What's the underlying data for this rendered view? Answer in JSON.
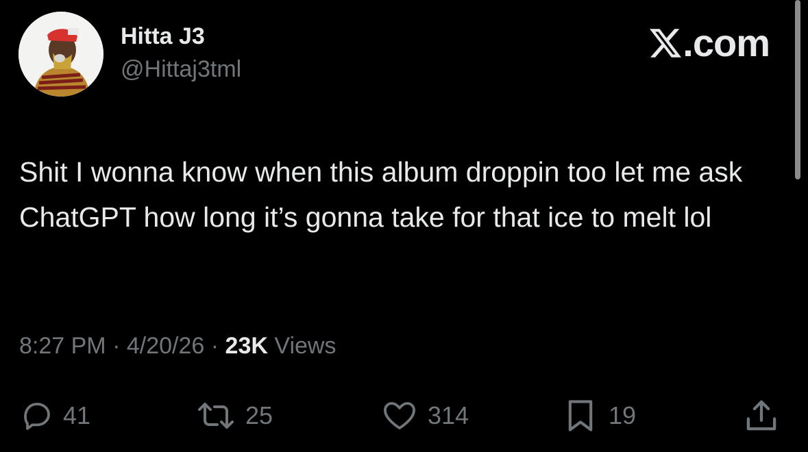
{
  "header": {
    "display_name": "Hitta J3",
    "handle": "@Hittaj3tml",
    "brand": ".com",
    "avatar_icon": "profile-photo"
  },
  "tweet": {
    "text": "Shit I wonna know when this album droppin too let me ask ChatGPT how long it’s gonna take for that ice to melt lol"
  },
  "meta": {
    "time": "8:27 PM",
    "separator": "·",
    "date": "4/20/26",
    "views_count": "23K",
    "views_label": "Views"
  },
  "actions": {
    "replies": "41",
    "reposts": "25",
    "likes": "314",
    "bookmarks": "19",
    "icons": [
      "reply-icon",
      "repost-icon",
      "like-icon",
      "bookmark-icon",
      "share-icon"
    ]
  },
  "colors": {
    "background": "#000000",
    "primary_text": "#e7e9ea",
    "secondary_text": "#71767b"
  }
}
